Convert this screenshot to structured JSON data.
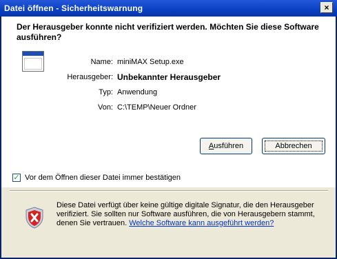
{
  "window": {
    "title": "Datei öffnen - Sicherheitswarnung",
    "close_glyph": "×"
  },
  "question": "Der Herausgeber konnte nicht verifiziert werden. Möchten Sie diese Software ausführen?",
  "details": {
    "name_label": "Name:",
    "name_value": "miniMAX Setup.exe",
    "publisher_label": "Herausgeber:",
    "publisher_value": "Unbekannter Herausgeber",
    "type_label": "Typ:",
    "type_value": "Anwendung",
    "from_label": "Von:",
    "from_value": "C:\\TEMP\\Neuer Ordner"
  },
  "buttons": {
    "run_label_accel": "A",
    "run_label_rest": "usführen",
    "cancel_label": "Abbrechen"
  },
  "checkbox": {
    "checked": true,
    "check_glyph": "✓",
    "label": "Vor dem Öffnen dieser Datei immer bestätigen"
  },
  "warning": {
    "text": "Diese Datei verfügt über keine gültige digitale Signatur, die den Herausgeber verifiziert. Sie sollten nur Software ausführen, die von Herausgebern stammt, denen Sie vertrauen.",
    "link": "Welche Software kann ausgeführt werden?"
  },
  "icons": {
    "file": "application-file-icon",
    "shield": "security-shield-icon"
  },
  "colors": {
    "titlebar": "#0a3fc2",
    "shield_red": "#d32424",
    "link": "#0033cc"
  }
}
